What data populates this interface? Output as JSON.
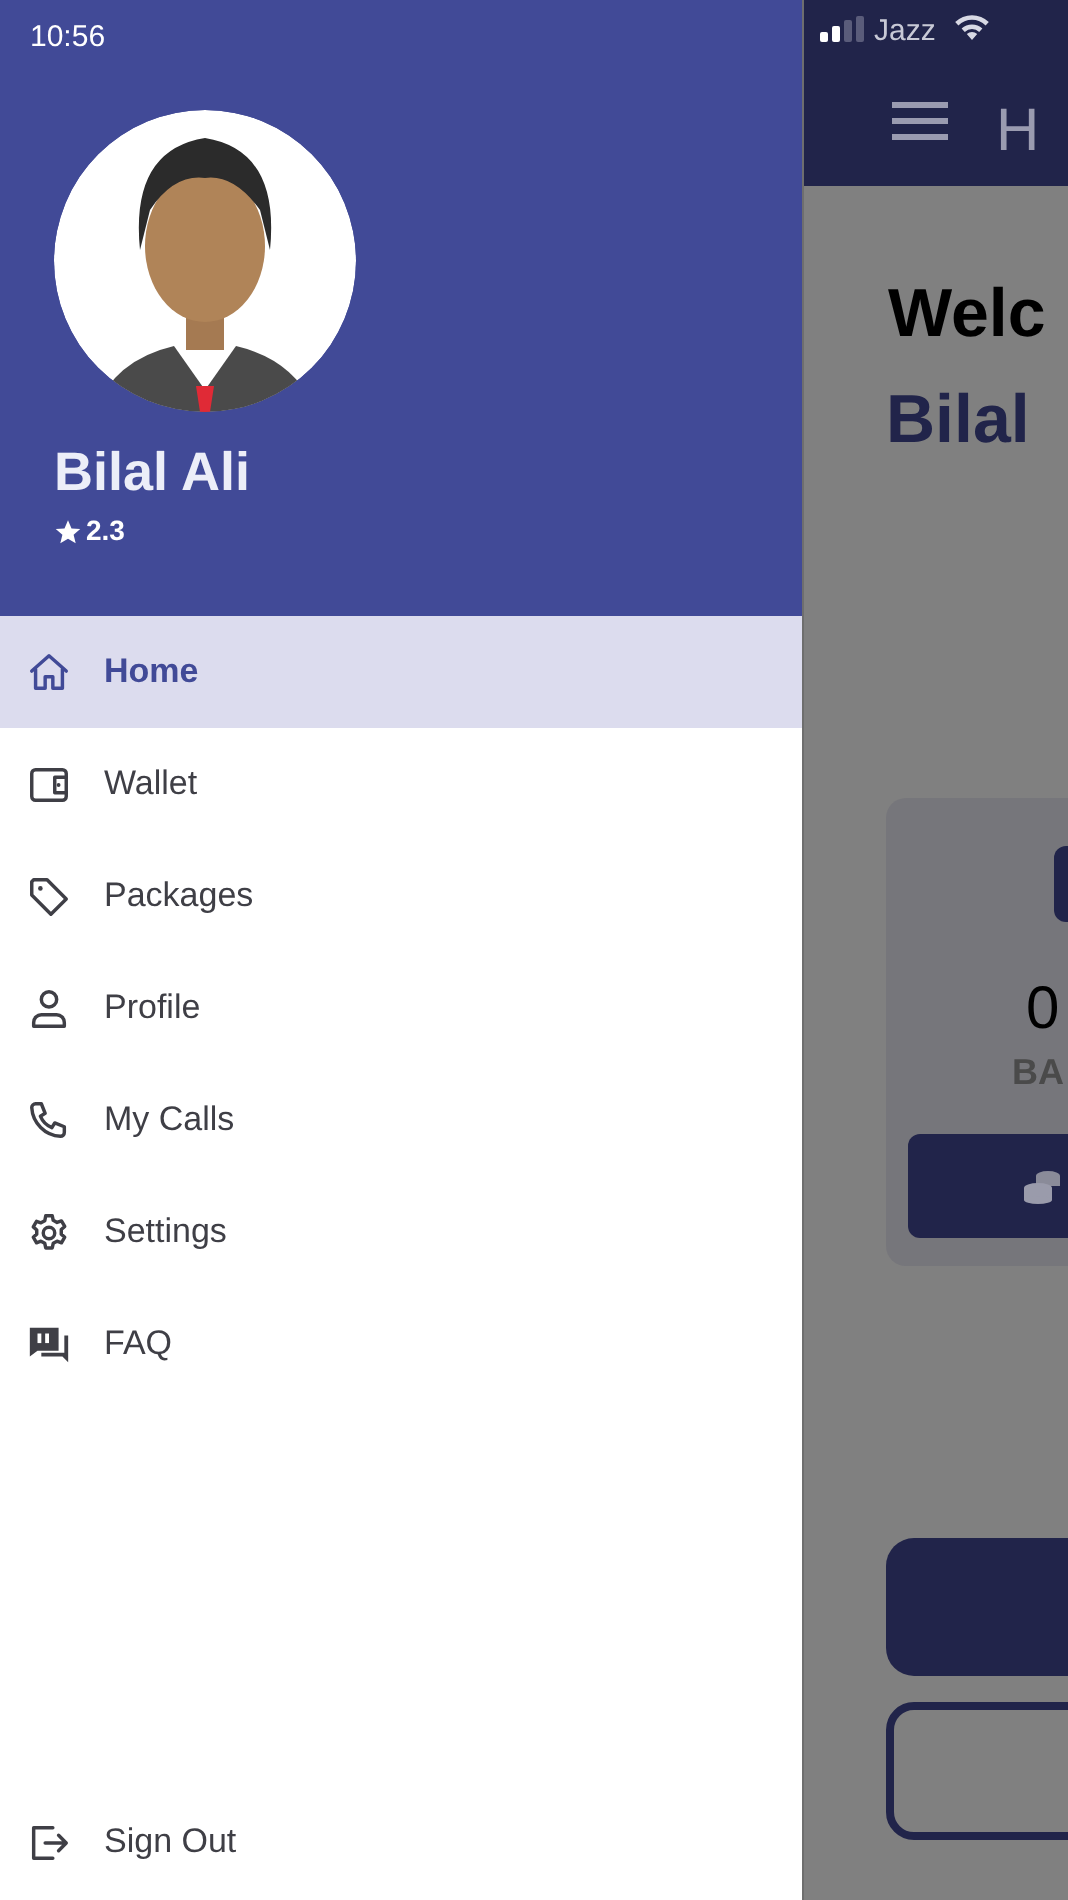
{
  "status_bar": {
    "time": "10:56",
    "carrier": "Jazz"
  },
  "drawer": {
    "profile": {
      "name": "Bilal Ali",
      "rating": "2.3"
    },
    "menu": [
      {
        "label": "Home",
        "selected": true
      },
      {
        "label": "Wallet",
        "selected": false
      },
      {
        "label": "Packages",
        "selected": false
      },
      {
        "label": "Profile",
        "selected": false
      },
      {
        "label": "My Calls",
        "selected": false
      },
      {
        "label": "Settings",
        "selected": false
      },
      {
        "label": "FAQ",
        "selected": false
      }
    ],
    "sign_out": "Sign Out"
  },
  "background_screen": {
    "app_bar_title": "H",
    "welcome": "Welc",
    "user_name": "Bilal",
    "balance": "0",
    "balance_label": "BA"
  }
}
